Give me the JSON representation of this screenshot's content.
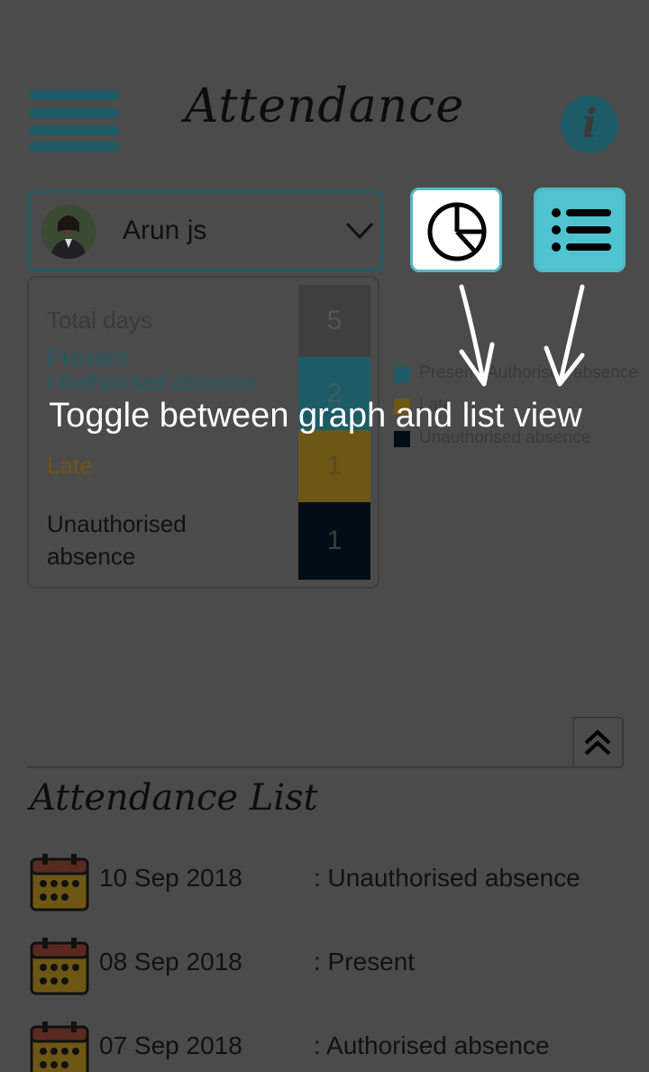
{
  "header": {
    "title": "Attendance",
    "info_label": "i"
  },
  "student": {
    "name": "Arun js"
  },
  "summary": {
    "total_label": "Total days",
    "total_value": "5",
    "present_label": "Present",
    "present_sublabel": "/ Authorised absence",
    "present_value": "2",
    "late_label": "Late",
    "late_value": "1",
    "unauth_label": "Unauthorised absence",
    "unauth_value": "1"
  },
  "legend": [
    {
      "label": "Present/ Authorised absence",
      "color": "#1d5c66"
    },
    {
      "label": "Late",
      "color": "#6e5614"
    },
    {
      "label": "Unauthorised absence",
      "color": "#020e17"
    }
  ],
  "tooltip": {
    "text": "Toggle between graph and list view"
  },
  "list": {
    "title": "Attendance List",
    "rows": [
      {
        "date": "10 Sep 2018",
        "status": ": Unauthorised absence"
      },
      {
        "date": "08 Sep 2018",
        "status": ": Present"
      },
      {
        "date": "07 Sep 2018",
        "status": ": Authorised absence"
      }
    ]
  },
  "colors": {
    "accent": "#4fc3d0",
    "teal_dark": "#1d5c66",
    "overlay_bg": "#4b4b4b"
  }
}
